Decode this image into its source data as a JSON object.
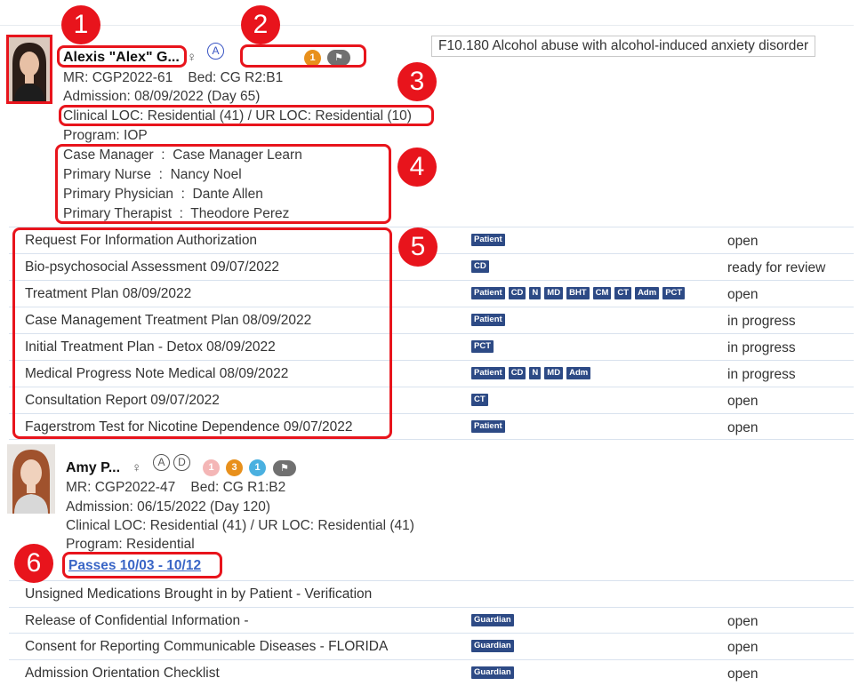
{
  "callouts": [
    "1",
    "2",
    "3",
    "4",
    "5",
    "6"
  ],
  "patient1": {
    "name": "Alexis \"Alex\" G...",
    "gender_symbol": "♀",
    "status_letters": [
      "A"
    ],
    "count_badge": "1",
    "flag_icon": "flag-icon",
    "diagnosis": "F10.180 Alcohol abuse with alcohol-induced anxiety disorder",
    "mr_line": "MR: CGP2022-61    Bed: CG R2:B1",
    "admission": "Admission: 08/09/2022 (Day 65)",
    "loc": "Clinical LOC: Residential (41) / UR LOC: Residential (10)",
    "program": "Program: IOP",
    "care_team": [
      "Case Manager  :  Case Manager Learn",
      "Primary Nurse  :  Nancy Noel",
      "Primary Physician  :  Dante Allen",
      "Primary Therapist  :  Theodore Perez"
    ],
    "documents": [
      {
        "title": "Request For Information Authorization",
        "tags": [
          "Patient"
        ],
        "status": "open"
      },
      {
        "title": "Bio-psychosocial Assessment 09/07/2022",
        "tags": [
          "CD"
        ],
        "status": "ready for review"
      },
      {
        "title": "Treatment Plan 08/09/2022",
        "tags": [
          "Patient",
          "CD",
          "N",
          "MD",
          "BHT",
          "CM",
          "CT",
          "Adm",
          "PCT"
        ],
        "status": "open"
      },
      {
        "title": "Case Management Treatment Plan 08/09/2022",
        "tags": [
          "Patient"
        ],
        "status": "in progress"
      },
      {
        "title": "Initial Treatment Plan - Detox 08/09/2022",
        "tags": [
          "PCT"
        ],
        "status": "in progress"
      },
      {
        "title": "Medical Progress Note Medical 08/09/2022",
        "tags": [
          "Patient",
          "CD",
          "N",
          "MD",
          "Adm"
        ],
        "status": "in progress"
      },
      {
        "title": "Consultation Report 09/07/2022",
        "tags": [
          "CT"
        ],
        "status": "open"
      },
      {
        "title": "Fagerstrom Test for Nicotine Dependence 09/07/2022",
        "tags": [
          "Patient"
        ],
        "status": "open"
      }
    ]
  },
  "patient2": {
    "name": "Amy P...",
    "gender_symbol": "♀",
    "status_letters": [
      "A",
      "D"
    ],
    "count_badges": [
      {
        "value": "1",
        "color": "#f4b6b6"
      },
      {
        "value": "3",
        "color": "#e8901c"
      },
      {
        "value": "1",
        "color": "#4ab0e0"
      }
    ],
    "flag_icon": "flag-icon",
    "mr_line": "MR: CGP2022-47    Bed: CG R1:B2",
    "admission": "Admission: 06/15/2022 (Day 120)",
    "loc": "Clinical LOC: Residential (41) / UR LOC: Residential (41)",
    "program": "Program: Residential",
    "passes_link": "Passes 10/03 - 10/12",
    "documents": [
      {
        "title": "Unsigned Medications Brought in by Patient - Verification",
        "tags": [],
        "status": ""
      },
      {
        "title": "Release of Confidential Information -",
        "tags": [
          "Guardian"
        ],
        "status": "open"
      },
      {
        "title": "Consent for Reporting Communicable Diseases - FLORIDA",
        "tags": [
          "Guardian"
        ],
        "status": "open"
      },
      {
        "title": "Admission Orientation Checklist",
        "tags": [
          "Guardian"
        ],
        "status": "open"
      }
    ]
  },
  "colors": {
    "callout_red": "#e8141c",
    "tag_navy": "#2d4a85",
    "link_blue": "#3a66c6",
    "badge_orange": "#e8901c"
  }
}
